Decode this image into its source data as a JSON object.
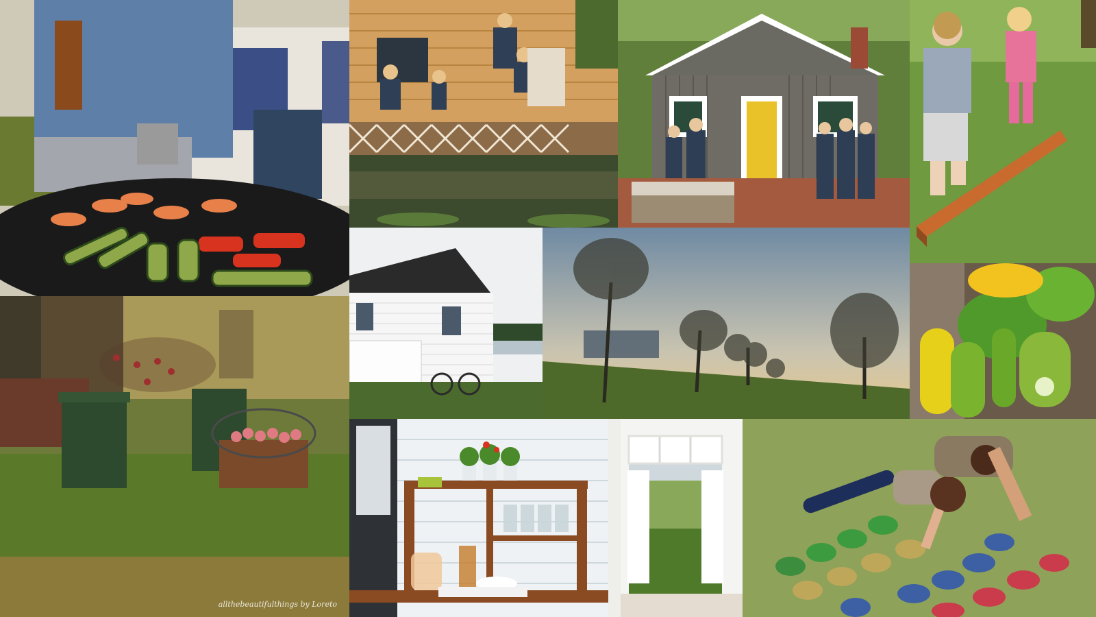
{
  "collage": {
    "photos": [
      {
        "name": "grilling-shrimp-vegetables"
      },
      {
        "name": "family-on-lakeside-deck"
      },
      {
        "name": "grey-cottage-yellow-door-gathering"
      },
      {
        "name": "kids-on-balance-beam"
      },
      {
        "name": "autumn-garden-basket-apples"
      },
      {
        "name": "white-cottage-with-bicycle"
      },
      {
        "name": "meadow-trees-at-dusk"
      },
      {
        "name": "zucchini-and-squash-blossoms"
      },
      {
        "name": "outdoor-drink-station-shelf"
      },
      {
        "name": "open-french-doors-to-lawn"
      },
      {
        "name": "lawn-twister-game"
      }
    ],
    "signature": "allthebeautifulthings by Loreto"
  }
}
